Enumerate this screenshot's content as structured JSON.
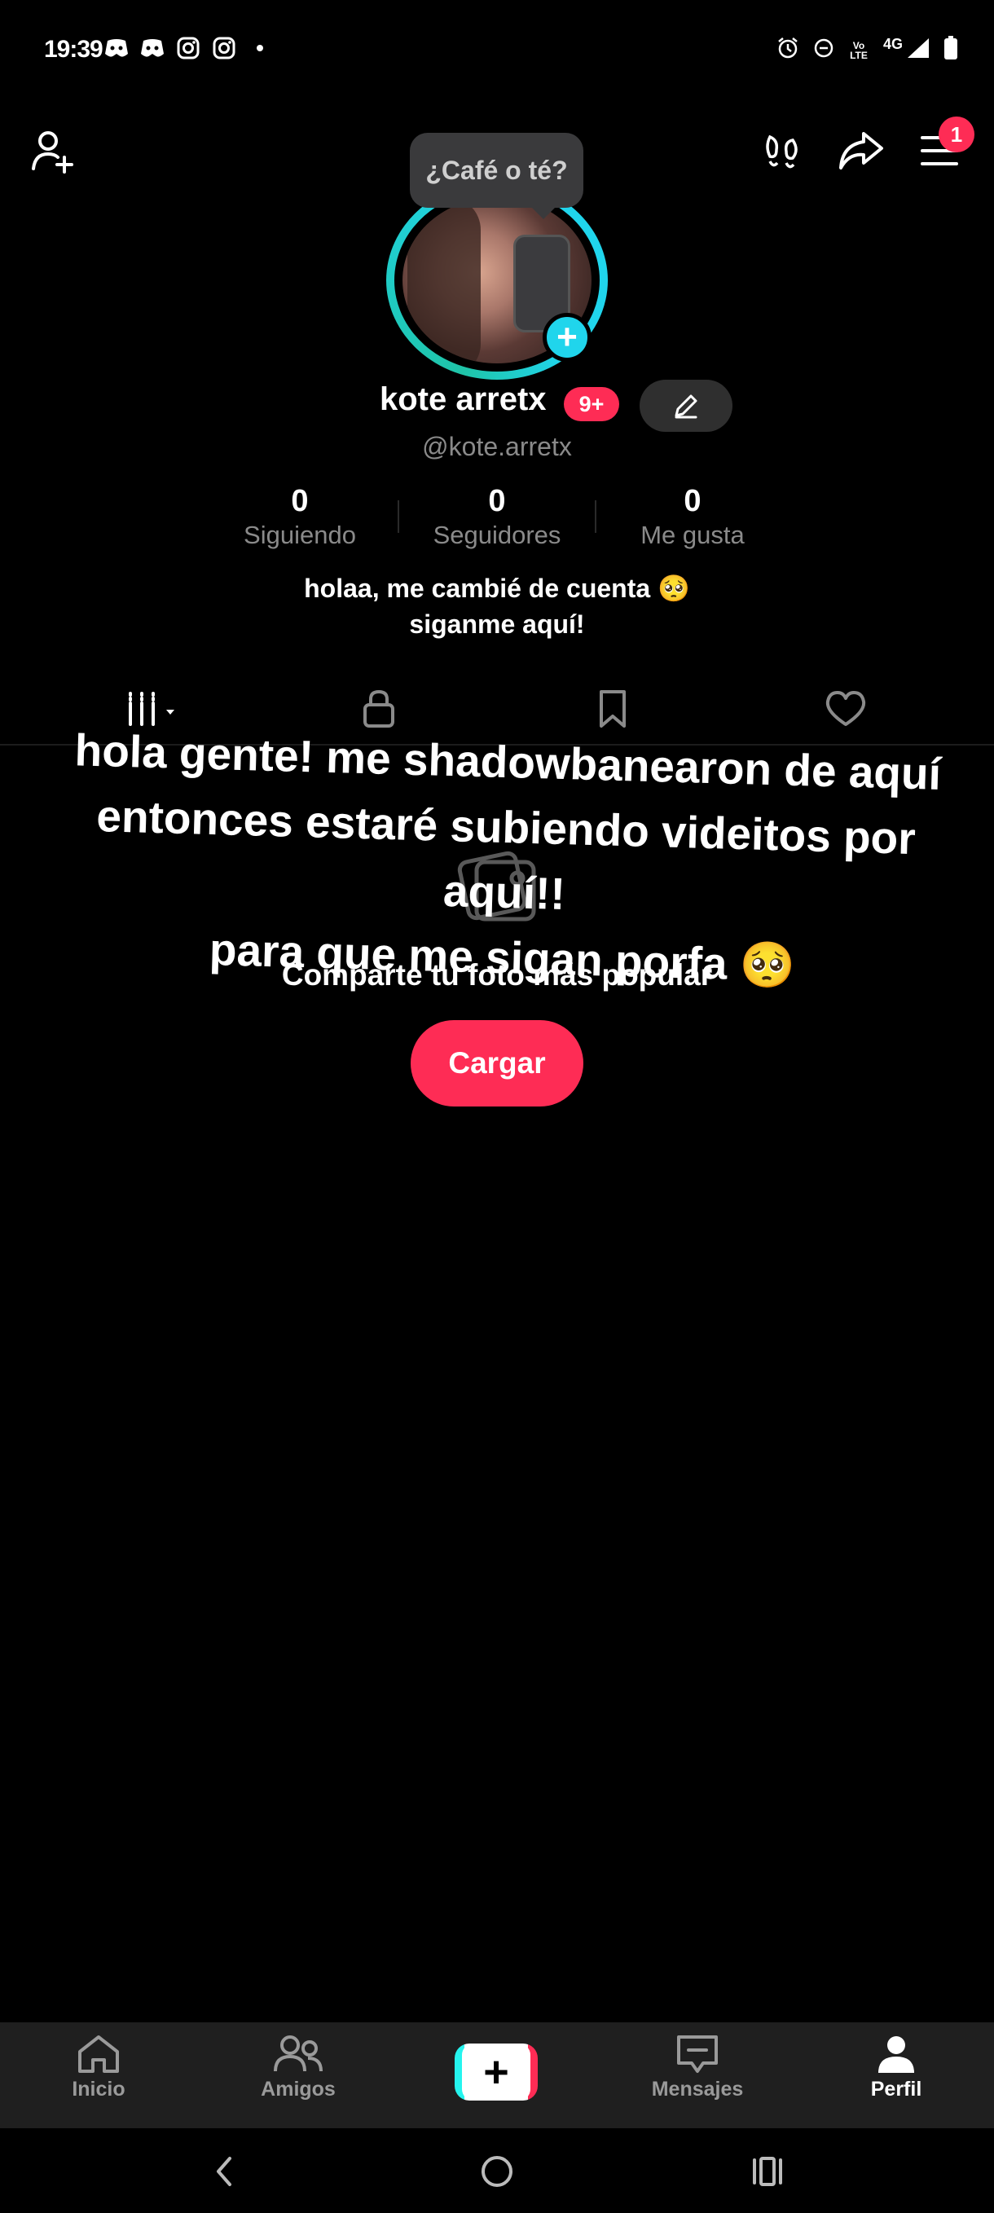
{
  "status_bar": {
    "time": "19:39",
    "left_icons": [
      "discord-icon",
      "discord-icon",
      "instagram-icon",
      "instagram-icon",
      "dot-icon"
    ],
    "network_label": "4G",
    "volte_label": "Vo LTE"
  },
  "top_bar": {
    "add_friend_icon": "person-add-icon",
    "footprint_icon": "footprints-icon",
    "share_icon": "share-arrow-icon",
    "menu_icon": "menu-icon",
    "menu_badge": "1"
  },
  "profile": {
    "tooltip": "¿Café o té?",
    "display_name": "kote arretx",
    "name_badge": "9+",
    "handle": "@kote.arretx",
    "stats": [
      {
        "value": "0",
        "label": "Siguiendo"
      },
      {
        "value": "0",
        "label": "Seguidores"
      },
      {
        "value": "0",
        "label": "Me gusta"
      }
    ],
    "bio_line1": "holaa, me cambié de cuenta 🥺",
    "bio_line2": "siganme aquí!"
  },
  "tabs": [
    "grid-icon",
    "lock-icon",
    "bookmark-icon",
    "heart-icon"
  ],
  "overlay_text": {
    "line1": "hola gente! me shadowbanearon de aquí",
    "line2": "entonces estaré subiendo videitos por aquí!!",
    "line3": "para que me sigan porfa 🥺"
  },
  "empty_state": {
    "title": "Comparte tu foto más popular",
    "button": "Cargar"
  },
  "bottom_nav": [
    {
      "label": "Inicio",
      "icon": "home-icon"
    },
    {
      "label": "Amigos",
      "icon": "friends-icon"
    },
    {
      "label": "",
      "icon": "plus-icon"
    },
    {
      "label": "Mensajes",
      "icon": "message-icon"
    },
    {
      "label": "Perfil",
      "icon": "profile-icon"
    }
  ],
  "colors": {
    "accent": "#fe2c55",
    "ring": "#20d5ec",
    "background": "#000000",
    "nav_background": "#1f1f1f"
  }
}
